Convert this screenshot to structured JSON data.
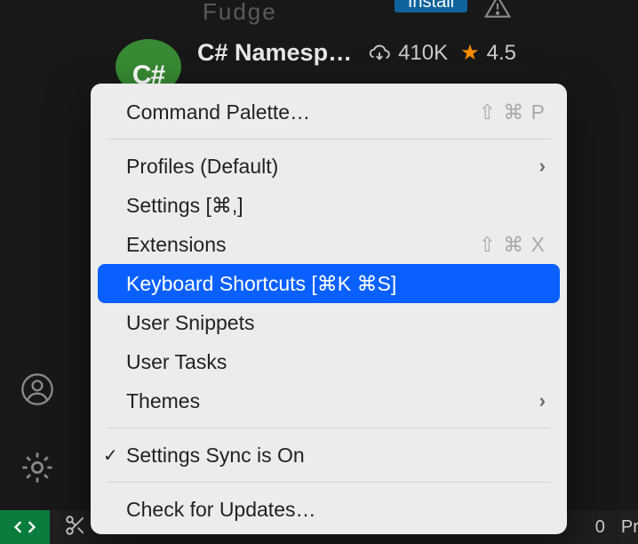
{
  "background": {
    "partial_text": "Fudge",
    "install_label": "Install"
  },
  "extension": {
    "icon_text": "C#",
    "title": "C# Namesp…",
    "downloads": "410K",
    "rating": "4.5"
  },
  "menu": {
    "command_palette": "Command Palette…",
    "command_palette_short": "⇧ ⌘ P",
    "profiles": "Profiles (Default)",
    "settings": "Settings [⌘,]",
    "extensions": "Extensions",
    "extensions_short": "⇧ ⌘ X",
    "keyboard_shortcuts": "Keyboard Shortcuts [⌘K ⌘S]",
    "user_snippets": "User Snippets",
    "user_tasks": "User Tasks",
    "themes": "Themes",
    "settings_sync": "Settings Sync is On",
    "check_updates": "Check for Updates…"
  },
  "status": {
    "problems": "0",
    "right_label": "Pro"
  }
}
